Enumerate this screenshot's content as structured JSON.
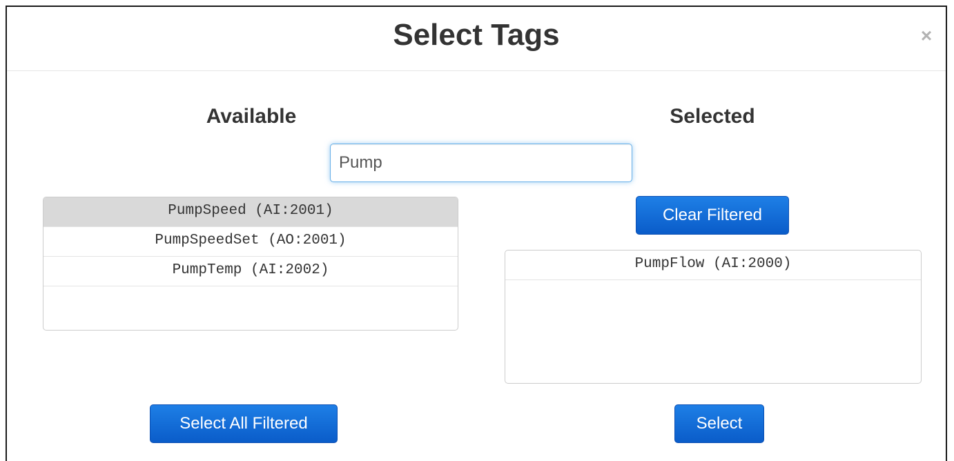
{
  "modal": {
    "title": "Select Tags",
    "close_label": "×"
  },
  "available": {
    "heading": "Available",
    "items": [
      {
        "label": "PumpSpeed (AI:2001)"
      },
      {
        "label": "PumpSpeedSet (AO:2001)"
      },
      {
        "label": "PumpTemp (AI:2002)"
      }
    ],
    "select_all_label": "Select All Filtered"
  },
  "filter": {
    "value": "Pump",
    "focus_color": "#66afe9"
  },
  "selected": {
    "heading": "Selected",
    "clear_label": "Clear Filtered",
    "items": [
      {
        "label": "PumpFlow (AI:2000)"
      }
    ],
    "select_label": "Select"
  },
  "colors": {
    "button_blue": "#0a5cc9",
    "highlight_row": "#d9d9d9"
  }
}
